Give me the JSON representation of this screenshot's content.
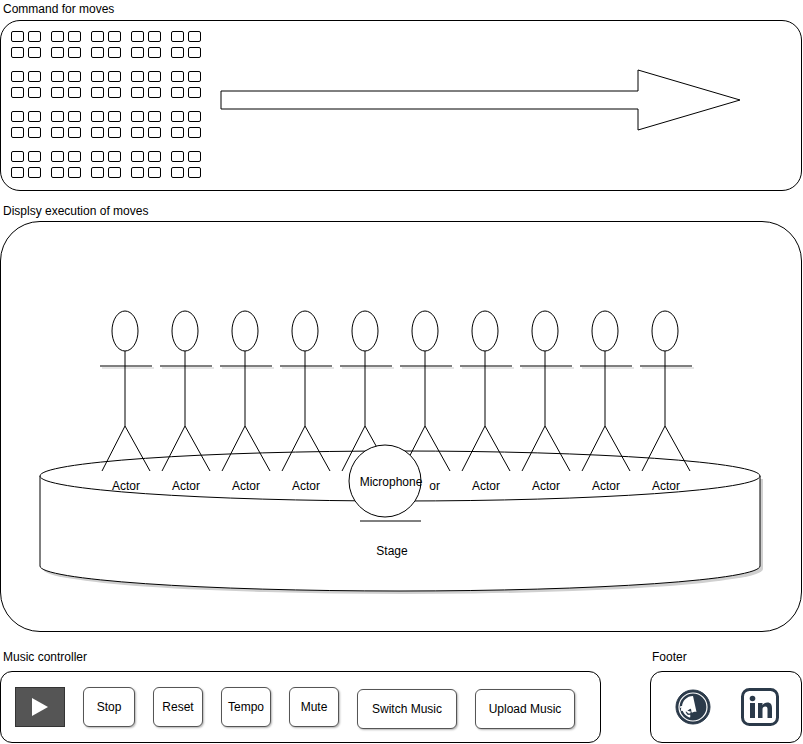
{
  "sections": {
    "commands": "Command for moves",
    "display": "Displsy execution of moves",
    "music": "Music controller",
    "footer": "Footer"
  },
  "stage": {
    "label": "Stage",
    "microphone": "Microphone",
    "actors": [
      {
        "label": "Actor"
      },
      {
        "label": "Actor"
      },
      {
        "label": "Actor"
      },
      {
        "label": "Actor"
      },
      {
        "label": null
      },
      {
        "label": "or"
      },
      {
        "label": "Actor"
      },
      {
        "label": "Actor"
      },
      {
        "label": "Actor"
      },
      {
        "label": "Actor"
      }
    ]
  },
  "music": {
    "play": {
      "selected": true
    },
    "buttons": [
      "Stop",
      "Reset",
      "Tempo",
      "Mute",
      "Switch Music",
      "Upload Music"
    ]
  }
}
